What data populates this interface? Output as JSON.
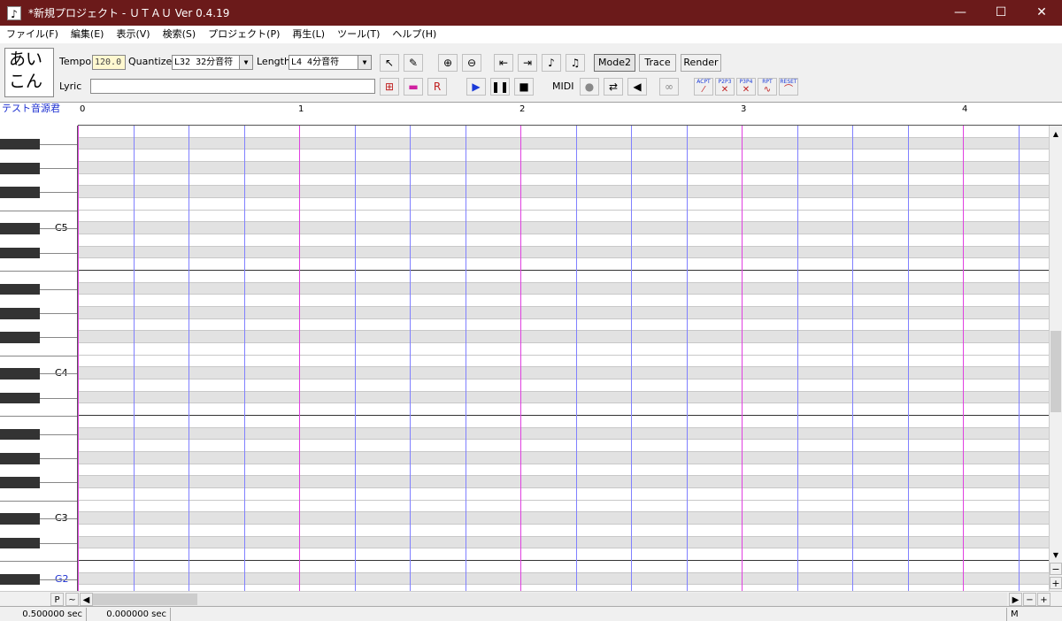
{
  "window": {
    "title": "*新規プロジェクト - ＵＴＡＵ Ver 0.4.19",
    "app_icon": "♪",
    "minimize": "—",
    "maximize": "☐",
    "close": "✕"
  },
  "menu": [
    "ファイル(F)",
    "編集(E)",
    "表示(V)",
    "検索(S)",
    "プロジェクト(P)",
    "再生(L)",
    "ツール(T)",
    "ヘルプ(H)"
  ],
  "toolbar": {
    "kana_line1": "あい",
    "kana_line2": "こん",
    "tempo_label": "Tempo",
    "tempo_value": "120.0",
    "quantize_label": "Quantize",
    "quantize_value": "L32 32分音符",
    "length_label": "Length",
    "length_value": "L4  4分音符",
    "lyric_label": "Lyric",
    "lyric_value": "",
    "mode2": "Mode2",
    "trace": "Trace",
    "render": "Render",
    "midi": "MIDI",
    "curve_buttons": [
      {
        "label": "ACPT",
        "icon": "accept-curve-icon",
        "glyph": "⁄"
      },
      {
        "label": "P2P3",
        "icon": "p2p3-curve-icon",
        "glyph": "✕"
      },
      {
        "label": "P3P4",
        "icon": "p3p4-curve-icon",
        "glyph": "✕"
      },
      {
        "label": "RPT",
        "icon": "repeat-curve-icon",
        "glyph": "∿"
      },
      {
        "label": "RESET",
        "icon": "reset-curve-icon",
        "glyph": "⌒"
      }
    ]
  },
  "singer": "テスト音源君",
  "ruler": [
    "0",
    "1",
    "2",
    "3",
    "4"
  ],
  "piano": {
    "octaves": [
      "C5",
      "C4",
      "C3",
      "G2"
    ]
  },
  "scroll": {
    "p_button": "P",
    "tilde_button": "~",
    "minus": "−",
    "plus": "+"
  },
  "status": {
    "left_time": "0.500000 sec",
    "right_time": "0.000000 sec",
    "mode": "M"
  }
}
